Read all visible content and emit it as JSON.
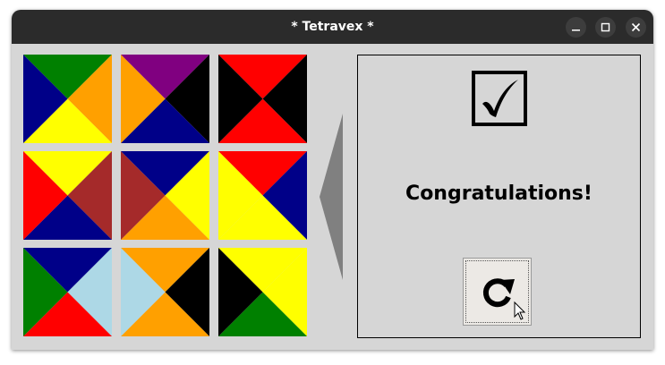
{
  "window": {
    "title": "* Tetravex *",
    "controls": [
      "minimize-icon",
      "maximize-icon",
      "close-icon"
    ]
  },
  "colors": {
    "navy": "#000088",
    "green": "#008000",
    "orange": "#ffa000",
    "yellow": "#ffff00",
    "purple": "#800080",
    "black": "#000000",
    "red": "#ff0000",
    "brown": "#a52a2a",
    "lightblue": "#add8e6"
  },
  "board": {
    "tiles": [
      {
        "top": "green",
        "right": "orange",
        "bottom": "yellow",
        "left": "navy"
      },
      {
        "top": "purple",
        "right": "black",
        "bottom": "navy",
        "left": "orange"
      },
      {
        "top": "red",
        "right": "black",
        "bottom": "red",
        "left": "black"
      },
      {
        "top": "yellow",
        "right": "brown",
        "bottom": "navy",
        "left": "red"
      },
      {
        "top": "navy",
        "right": "yellow",
        "bottom": "orange",
        "left": "brown"
      },
      {
        "top": "red",
        "right": "navy",
        "bottom": "yellow",
        "left": "yellow"
      },
      {
        "top": "navy",
        "right": "lightblue",
        "bottom": "red",
        "left": "green"
      },
      {
        "top": "orange",
        "right": "black",
        "bottom": "orange",
        "left": "lightblue"
      },
      {
        "top": "yellow",
        "right": "yellow",
        "bottom": "green",
        "left": "black"
      }
    ]
  },
  "panel": {
    "status_icon": "checkmark-icon",
    "message": "Congratulations!",
    "restart_icon": "restart-icon"
  }
}
